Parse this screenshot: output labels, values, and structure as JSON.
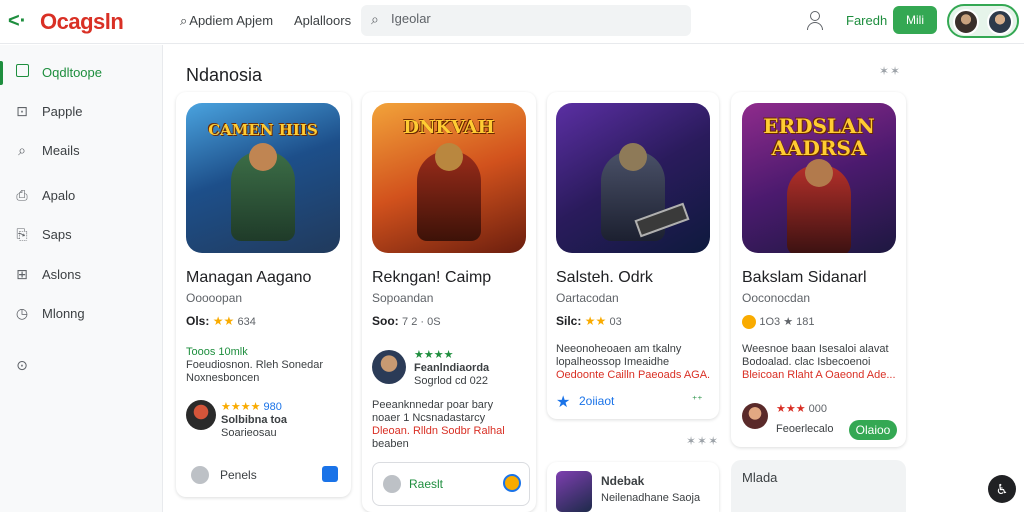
{
  "header": {
    "back_icon": "arrow-left-icon",
    "logo": "Ocagsln",
    "nav1": "Apdiem Apjem",
    "nav2": "Aplalloors",
    "search_placeholder": "Igeolar",
    "text_link": "Faredh",
    "button_label": "Mili"
  },
  "sidebar": {
    "items": [
      {
        "label": "Oqdltoope",
        "icon": "grid-icon"
      },
      {
        "label": "Papple",
        "icon": "chart-icon"
      },
      {
        "label": "Meails",
        "icon": "search-icon"
      },
      {
        "label": "Apalo",
        "icon": "bag-icon"
      },
      {
        "label": "Saps",
        "icon": "doc-icon"
      },
      {
        "label": "Aslons",
        "icon": "stats-icon"
      },
      {
        "label": "Mlonng",
        "icon": "clock-icon"
      },
      {
        "label": "",
        "icon": "settings-icon"
      }
    ]
  },
  "section": {
    "title": "Ndanosia",
    "more": "✶✶"
  },
  "apps": [
    {
      "art_title": "CAMEN HIIS",
      "title": "Managan Aagano",
      "developer": "Ooooopan",
      "rating_label": "Ols:",
      "rating_stars": "★★",
      "rating_value": "634",
      "review_head": "Tooos 10mlk",
      "review_line1": "Foeudiosnon. Rleh Sonedar",
      "review_line2": "Noxnesboncen",
      "reviewer_stars": "★★★★",
      "reviewer_score": "980",
      "reviewer_name": "Solbibna toa",
      "reviewer_sub": "Soarieosau",
      "action_label": "Penels"
    },
    {
      "art_title": "DNKVAH",
      "title": "Rekngan! Caimp",
      "developer": "Sopoandan",
      "rating_label": "Soo:",
      "rating_stars": "",
      "rating_value": "7 2 · 0S",
      "reviewer_stars": "★★★★",
      "reviewer_name": "Feanlndiaorda",
      "reviewer_sub": "Sogrlod cd 022",
      "review_line1": "Peeanknnedar poar bary",
      "review_line2": "noaer 1 Ncsnadastarcy",
      "review_line3": "Dleoan. Rlldn Sodbr Ralhal",
      "review_line4": "beaben",
      "action_label": "Raeslt"
    },
    {
      "art_title": "",
      "title": "Salsteh. Odrk",
      "developer": "Oartacodan",
      "rating_label": "Silc:",
      "rating_stars": "★★",
      "rating_value": "03",
      "review_line1": "Neeonoheoaen am tkalny",
      "review_line2": "lopalheossop Imeaidhe",
      "review_line3": "Oedoonte Cailln Paeoads AGA.",
      "link_label": "2oiiaot",
      "mini_title": "Ndebak",
      "mini_sub": "Neilenadhane Saoja",
      "more": "✶✶✶"
    },
    {
      "art_title": "ERDSLAN AADRSA",
      "title": "Bakslam Sidanarl",
      "developer": "Ooconocdan",
      "rating_value": "1O3 ★ 181",
      "review_line1": "Weesnoe baan Isesaloi alavat",
      "review_line2": "Bodoalad. clac Isbecoenoi",
      "review_line3": "Bleicoan Rlaht A Oaeond Ade...",
      "reviewer_score": "000",
      "reviewer_name": "Feoerlecalo",
      "pill_label": "Olaioo",
      "mini_title": "Mlada"
    }
  ],
  "colors": {
    "accent": "#1e8e3e",
    "brand": "#d93025",
    "star": "#f9ab00"
  }
}
